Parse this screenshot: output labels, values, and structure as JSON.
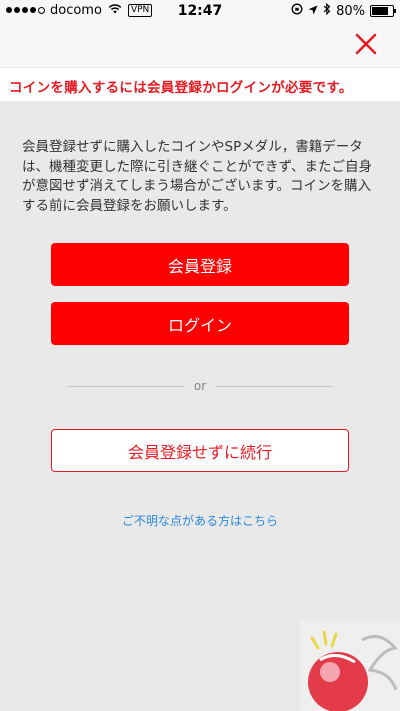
{
  "status_bar": {
    "carrier": "docomo",
    "vpn_label": "VPN",
    "time": "12:47",
    "battery_percent": "80%",
    "battery_level": 0.8
  },
  "nav": {
    "close_icon": "close-icon"
  },
  "alert": {
    "text": "コインを購入するには会員登録かログインが必要です。",
    "color": "#e51c23"
  },
  "description": "会員登録せずに購入したコインやSPメダル，書籍データは、機種変更した際に引き継ぐことができず、またご自身が意図せず消えてしまう場合がございます。コインを購入する前に会員登録をお願いします。",
  "buttons": {
    "register": "会員登録",
    "login": "ログイン",
    "continue_without": "会員登録せずに続行"
  },
  "divider_text": "or",
  "help_link": "ご不明な点がある方はこちら",
  "colors": {
    "primary": "#ff0000",
    "link": "#2a88d8",
    "background": "#e9e9e9"
  }
}
